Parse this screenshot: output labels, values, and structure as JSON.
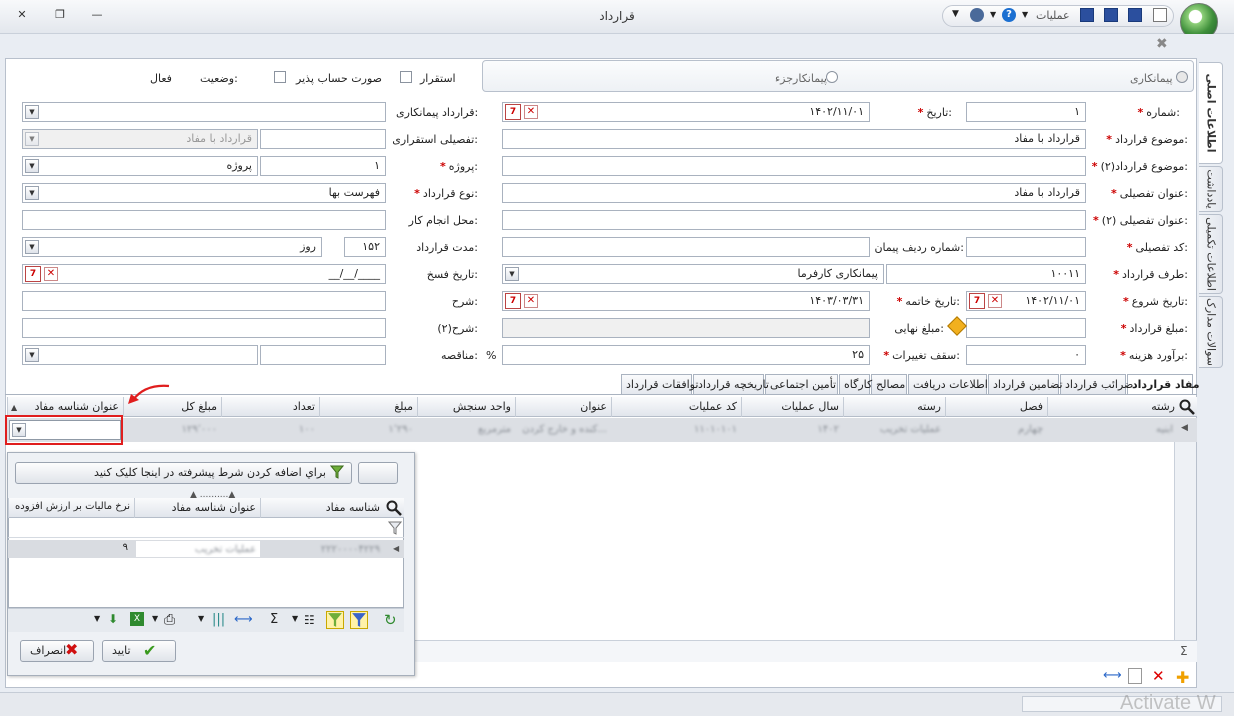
{
  "window": {
    "title": "قرارداد",
    "close_glyph": "✕",
    "restore_glyph": "❐",
    "minimize_glyph": "—"
  },
  "quick_access": {
    "operations_label": "عملیات"
  },
  "panel_close_glyph": "✖",
  "top_options": {
    "status_label": "وضعیت:",
    "status_value": "فعال",
    "billable_label": "صورت حساب پذیر",
    "settlement_label": "استقرار",
    "radio_contracting": "پیمانکاری",
    "radio_partial": "پیمانکارجزء"
  },
  "side_tabs": [
    "اطلاعات اصلی",
    "یادداشت",
    "اطلاعات تکمیلی",
    "سوالات مدارک"
  ],
  "form": {
    "number_label": "شماره:",
    "number_value": "۱",
    "date_label": "تاریخ:",
    "date_value": "۱۴۰۲/۱۱/۰۱",
    "contractor_contract_label": "قرارداد پیمانکاری:",
    "subject_label": "موضوع قرارداد:",
    "subject_value": "قرارداد با مفاد",
    "detail_settlement_label": "تفصیلی استقراری:",
    "detail_settlement_value": "قرارداد با مفاد",
    "subject2_label": "موضوع قرارداد(۲):",
    "project_label": "پروژه:",
    "project_value": "۱",
    "project_name": "پروژه",
    "detail_title_label": "عنوان تفصیلی:",
    "detail_title_value": "قرارداد با مفاد",
    "contract_type_label": "نوع قرارداد:",
    "contract_type_value": "فهرست بها",
    "detail_title2_label": "عنوان تفصیلی (۲):",
    "work_place_label": "محل انجام کار:",
    "detail_code_label": "کد تفصیلی:",
    "row_number_label": "شماره ردیف پیمان:",
    "duration_label": "مدت قرارداد:",
    "duration_value": "۱۵۲",
    "duration_unit": "روز",
    "party_label": "طرف قرارداد:",
    "party_code": "۱۰۰۱۱",
    "party_name": "پیمانکاری کارفرما",
    "termination_date_label": "تاریخ فسخ:",
    "termination_date_value": "__/__/____",
    "start_date_label": "تاریخ شروع:",
    "start_date_value": "۱۴۰۲/۱۱/۰۱",
    "end_date_label": "تاریخ خاتمه:",
    "end_date_value": "۱۴۰۳/۰۳/۳۱",
    "description_label": "شرح:",
    "amount_label": "مبلغ قرارداد:",
    "final_amount_label": "مبلغ نهایی:",
    "description2_label": "شرح(۲):",
    "cost_estimate_label": "برآورد هزینه:",
    "cost_estimate_value": "۰",
    "change_cap_label": "سقف تغییرات:",
    "change_cap_value": "۲۵",
    "percent_sign": "%",
    "tender_label": "مناقصه:"
  },
  "tabs": [
    "مفاد قرارداد",
    "ضرائب قرارداد",
    "تضامین قرارداد",
    "اطلاعات دریافت",
    "مصالح",
    "کارگاه",
    "تأمین اجتماعی",
    "تاریخچه قرارداد",
    "توافقات قرارداد"
  ],
  "grid": {
    "columns": [
      "رشته",
      "فصل",
      "رسته",
      "سال عملیات",
      "کد عملیات",
      "عنوان",
      "واحد سنجش",
      "مبلغ",
      "تعداد",
      "مبلغ کل",
      "عنوان شناسه مفاد"
    ],
    "row": [
      "ابنیه",
      "چهارم",
      "عملیات تخریب",
      "۱۴۰۲",
      "۱۱۰۱۰۱۰۱",
      "کنده و خارج کردن...",
      "مترمربع",
      "۱٬۲۹۰",
      "۱۰۰",
      "۱۲۹٬۰۰۰"
    ]
  },
  "popup": {
    "advanced_button": "براي اضافه کردن شرط پيشرفته در اينجا کليک کنيد",
    "columns": [
      "شناسه مفاد",
      "عنوان شناسه مفاد",
      "نرخ ماليات بر ارزش افزوده"
    ],
    "row": [
      "۲۲۲۰۰۰۰۴۲۲۹",
      "عملیات تخریب",
      "۹"
    ],
    "ok_button": "تایید",
    "cancel_button": "انصراف"
  },
  "watermark": "Activate W"
}
